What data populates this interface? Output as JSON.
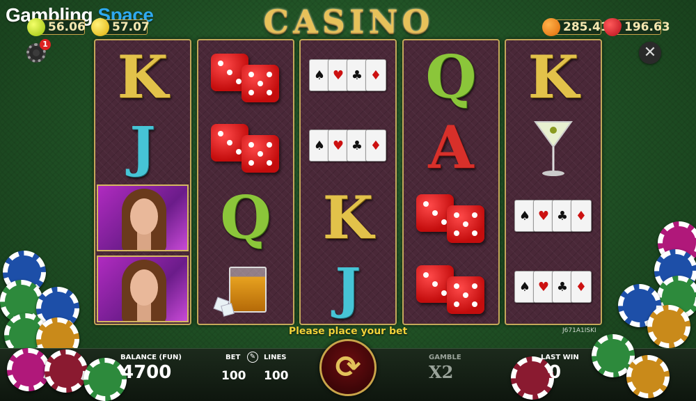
{
  "header": {
    "logo_part1": "Gambling",
    "logo_part2": "Space",
    "title": "CASINO",
    "fruits_left": [
      {
        "icon": "tennis-ball-icon",
        "value": "56.06"
      },
      {
        "icon": "lemon-icon",
        "value": "57.07"
      }
    ],
    "fruits_right": [
      {
        "icon": "orange-icon",
        "value": "285.41"
      },
      {
        "icon": "strawberry-icon",
        "value": "196.63"
      }
    ],
    "notification_count": "1",
    "close_glyph": "✕"
  },
  "reels": [
    [
      "K",
      "J",
      "woman-portrait",
      "woman-portrait"
    ],
    [
      "red-dice",
      "red-dice",
      "Q",
      "whiskey-glass"
    ],
    [
      "playing-cards",
      "playing-cards",
      "K",
      "J"
    ],
    [
      "Q",
      "A",
      "red-dice",
      "red-dice"
    ],
    [
      "K",
      "martini-glass",
      "playing-cards",
      "playing-cards"
    ]
  ],
  "status_message": "Please place your bet",
  "game_code": "J671A1ISKI",
  "footer": {
    "balance_label": "BALANCE (FUN)",
    "balance_value": "4700",
    "bet_label": "BET",
    "bet_value": "100",
    "lines_label": "LINES",
    "lines_value": "100",
    "gamble_label": "GAMBLE",
    "gamble_value": "X2",
    "last_win_label": "LAST WIN",
    "last_win_value": "0",
    "spin_glyph": "⟳"
  },
  "colors": {
    "felt": "#1f4f24",
    "gold": "#c9a54a",
    "status_yellow": "#f1d23a",
    "reel_bg": "#4a2838"
  }
}
